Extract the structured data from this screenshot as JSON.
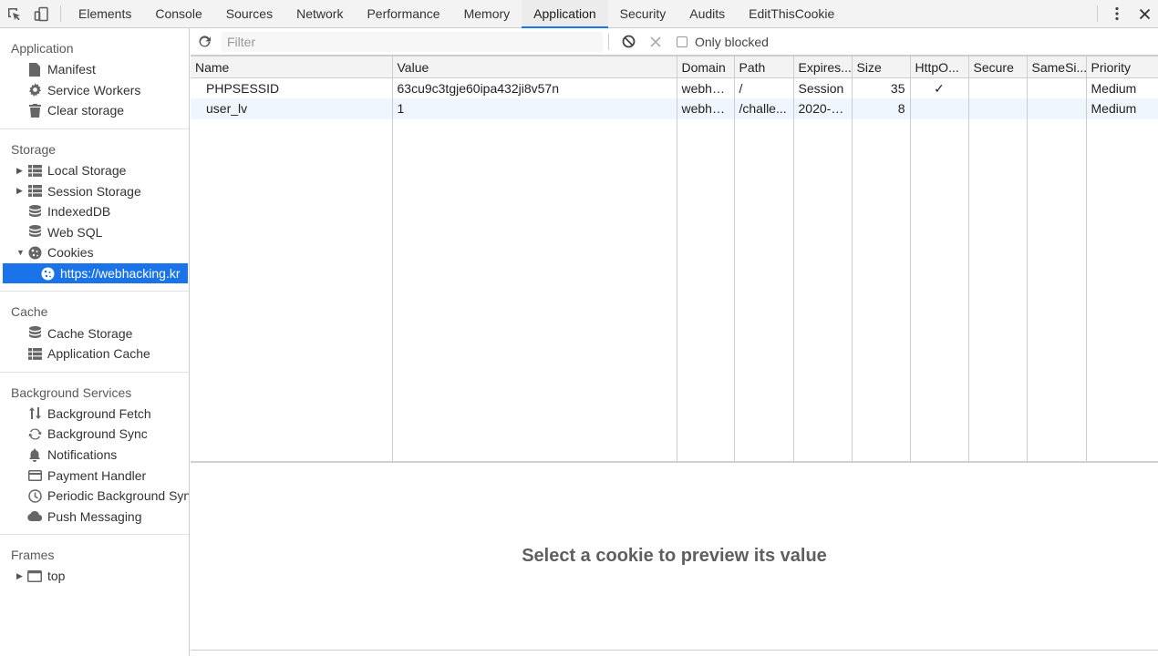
{
  "tabs": [
    {
      "label": "Elements"
    },
    {
      "label": "Console"
    },
    {
      "label": "Sources"
    },
    {
      "label": "Network"
    },
    {
      "label": "Performance"
    },
    {
      "label": "Memory"
    },
    {
      "label": "Application",
      "active": true
    },
    {
      "label": "Security"
    },
    {
      "label": "Audits"
    },
    {
      "label": "EditThisCookie"
    }
  ],
  "sidebar": {
    "application": {
      "title": "Application",
      "items": [
        "Manifest",
        "Service Workers",
        "Clear storage"
      ]
    },
    "storage": {
      "title": "Storage",
      "items": [
        "Local Storage",
        "Session Storage",
        "IndexedDB",
        "Web SQL",
        "Cookies"
      ],
      "cookie_child": "https://webhacking.kr"
    },
    "cache": {
      "title": "Cache",
      "items": [
        "Cache Storage",
        "Application Cache"
      ]
    },
    "background": {
      "title": "Background Services",
      "items": [
        "Background Fetch",
        "Background Sync",
        "Notifications",
        "Payment Handler",
        "Periodic Background Sync",
        "Push Messaging"
      ]
    },
    "frames": {
      "title": "Frames",
      "items": [
        "top"
      ]
    }
  },
  "toolbar": {
    "filter_placeholder": "Filter",
    "only_blocked": "Only blocked"
  },
  "table": {
    "columns": [
      "Name",
      "Value",
      "Domain",
      "Path",
      "Expires...",
      "Size",
      "HttpO...",
      "Secure",
      "SameSi...",
      "Priority"
    ],
    "rows": [
      {
        "name": "PHPSESSID",
        "value": "63cu9c3tgje60ipa432ji8v57n",
        "domain": "webha...",
        "path": "/",
        "expires": "Session",
        "size": "35",
        "httponly": "✓",
        "secure": "",
        "samesite": "",
        "priority": "Medium"
      },
      {
        "name": "user_lv",
        "value": "1",
        "domain": "webha...",
        "path": "/challe...",
        "expires": "2020-0...",
        "size": "8",
        "httponly": "",
        "secure": "",
        "samesite": "",
        "priority": "Medium"
      }
    ]
  },
  "preview": {
    "message": "Select a cookie to preview its value"
  }
}
